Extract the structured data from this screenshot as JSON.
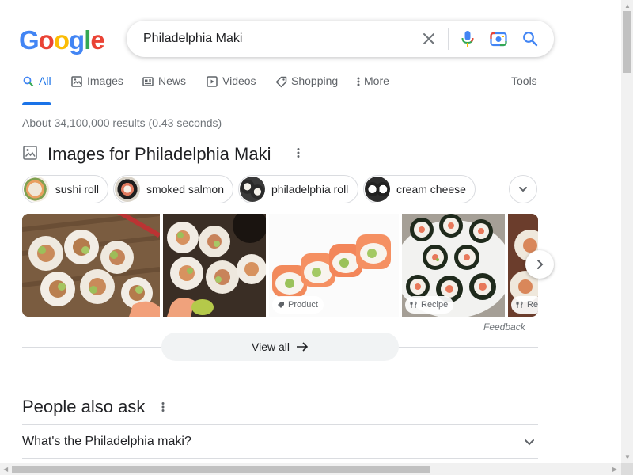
{
  "logo": {
    "letters": [
      {
        "ch": "G",
        "color": "#4285F4"
      },
      {
        "ch": "o",
        "color": "#EA4335"
      },
      {
        "ch": "o",
        "color": "#FBBC05"
      },
      {
        "ch": "g",
        "color": "#4285F4"
      },
      {
        "ch": "l",
        "color": "#34A853"
      },
      {
        "ch": "e",
        "color": "#EA4335"
      }
    ]
  },
  "search": {
    "query": "Philadelphia Maki",
    "icons": [
      "clear-icon",
      "microphone-icon",
      "camera-lens-icon",
      "search-icon"
    ]
  },
  "tabs": [
    {
      "label": "All",
      "icon": "search-icon",
      "active": true
    },
    {
      "label": "Images",
      "icon": "image-icon",
      "active": false
    },
    {
      "label": "News",
      "icon": "newspaper-icon",
      "active": false
    },
    {
      "label": "Videos",
      "icon": "play-icon",
      "active": false
    },
    {
      "label": "Shopping",
      "icon": "tag-icon",
      "active": false
    },
    {
      "label": "More",
      "icon": "kebab-icon",
      "active": false
    }
  ],
  "tools_label": "Tools",
  "stats": "About 34,100,000 results (0.43 seconds)",
  "images_section": {
    "title": "Images for Philadelphia Maki",
    "chips": [
      {
        "label": "sushi roll"
      },
      {
        "label": "smoked salmon"
      },
      {
        "label": "philadelphia roll"
      },
      {
        "label": "cream cheese"
      }
    ],
    "tiles": [
      {
        "badge": ""
      },
      {
        "badge": ""
      },
      {
        "badge": "Product",
        "badge_icon": "tag-icon"
      },
      {
        "badge": "Recipe",
        "badge_icon": "utensils-icon"
      },
      {
        "badge": "Re",
        "badge_icon": "utensils-icon"
      }
    ],
    "feedback": "Feedback",
    "view_all": "View all"
  },
  "paa": {
    "title": "People also ask",
    "questions": [
      "What's the Philadelphia maki?"
    ]
  },
  "colors": {
    "accent": "#1a73e8",
    "text": "#202124",
    "muted": "#70757a"
  }
}
